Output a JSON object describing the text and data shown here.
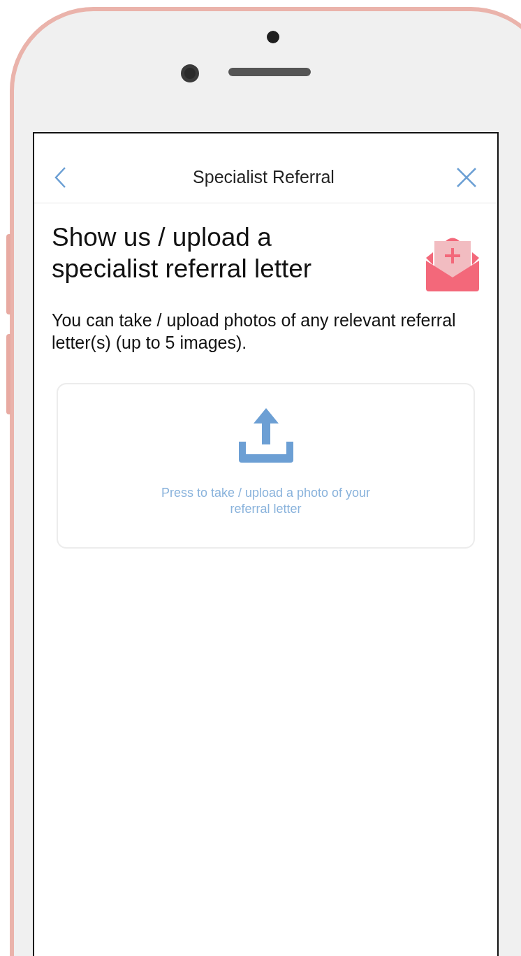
{
  "nav_bar": {
    "title": "Specialist Referral"
  },
  "heading": "Show us / upload a specialist referral letter",
  "description": "You can take / upload photos of any relevant referral letter(s) (up to 5 images).",
  "upload_card": {
    "label": "Press to take / upload a photo of your referral letter"
  }
}
